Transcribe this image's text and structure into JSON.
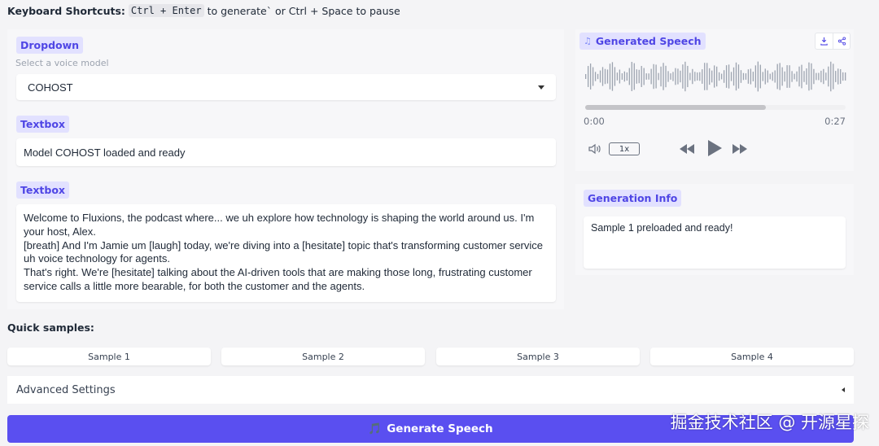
{
  "shortcuts": {
    "label": "Keyboard Shortcuts:",
    "key_combo": "Ctrl + Enter",
    "middle": "to generate` or Ctrl + Space to pause"
  },
  "voice_dropdown": {
    "label": "Dropdown",
    "info": "Select a voice model",
    "value": "COHOST"
  },
  "status_box": {
    "label": "Textbox",
    "value": "Model COHOST loaded and ready"
  },
  "script_box": {
    "label": "Textbox",
    "value": "Welcome to Fluxions, the podcast where... we uh explore how technology is shaping the world around us. I'm your host, Alex.\n[breath] And I'm Jamie um [laugh] today, we're diving into a [hesitate] topic that's transforming customer service uh voice technology for agents.\nThat's right. We're [hesitate] talking about the AI-driven tools that are making those long, frustrating customer service calls a little more bearable, for both the customer and the agents."
  },
  "audio": {
    "label": "Generated Speech",
    "current_time": "0:00",
    "duration": "0:27",
    "progress": 0.695,
    "speed": "1x"
  },
  "generation_info": {
    "label": "Generation Info",
    "value": "Sample 1 preloaded and ready!"
  },
  "quick_samples": {
    "label": "Quick samples:",
    "items": [
      "Sample 1",
      "Sample 2",
      "Sample 3",
      "Sample 4"
    ]
  },
  "advanced": {
    "label": "Advanced Settings"
  },
  "generate": {
    "icon": "🎵",
    "label": "Generate Speech"
  },
  "watermark": "掘金技术社区 @ 开源星探",
  "colors": {
    "accent": "#5a4ff0",
    "pill_bg": "#e2e1ff",
    "pill_text": "#4f46e5"
  }
}
